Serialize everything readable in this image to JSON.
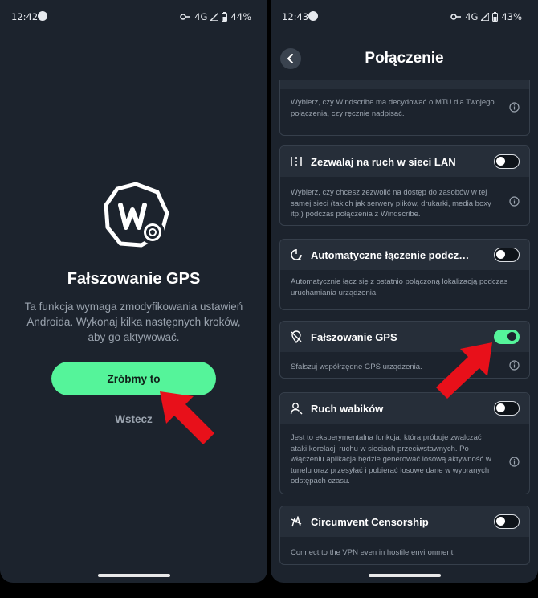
{
  "left": {
    "status": {
      "time": "12:42",
      "network": "4G",
      "battery": "44%"
    },
    "title": "Fałszowanie GPS",
    "description": "Ta funkcja wymaga zmodyfikowania ustawień Androida. Wykonaj kilka następnych kroków, aby go aktywować.",
    "primary_button": "Zróbmy to",
    "back_link": "Wstecz"
  },
  "right": {
    "status": {
      "time": "12:43",
      "network": "4G",
      "battery": "43%"
    },
    "page_title": "Połączenie",
    "cards": [
      {
        "label": "",
        "toggle_on": null,
        "icon": "mtu-icon",
        "description": "Wybierz, czy Windscribe ma decydować o MTU dla Twojego połączenia, czy ręcznie nadpisać."
      },
      {
        "label": "Zezwalaj na ruch w sieci LAN",
        "toggle_on": false,
        "icon": "lan-icon",
        "description": "Wybierz, czy chcesz zezwolić na dostęp do zasobów w tej samej sieci (takich jak serwery plików, drukarki, media boxy itp.) podczas połączenia z Windscribe."
      },
      {
        "label": "Automatyczne łączenie podcz…",
        "toggle_on": false,
        "icon": "auto-connect-icon",
        "description": "Automatycznie łącz się z ostatnio połączoną lokalizacją podczas uruchamiania urządzenia."
      },
      {
        "label": "Fałszowanie GPS",
        "toggle_on": true,
        "icon": "gps-off-icon",
        "description": "Sfałszuj współrzędne GPS urządzenia."
      },
      {
        "label": "Ruch wabików",
        "toggle_on": false,
        "icon": "decoy-user-icon",
        "description": "Jest to eksperymentalna funkcja, która próbuje zwalczać ataki korelacji ruchu w sieciach przeciwstawnych. Po włączeniu aplikacja będzie generować losową aktywność w tunelu oraz przesyłać i pobierać losowe dane w wybranych odstępach czasu."
      },
      {
        "label": "Circumvent Censorship",
        "toggle_on": false,
        "icon": "censorship-icon",
        "description": "Connect to the VPN even in hostile environment"
      }
    ]
  },
  "colors": {
    "background": "#1c232d",
    "accent": "#55f49a",
    "card_header": "#262e39",
    "arrow": "#e8101a"
  }
}
